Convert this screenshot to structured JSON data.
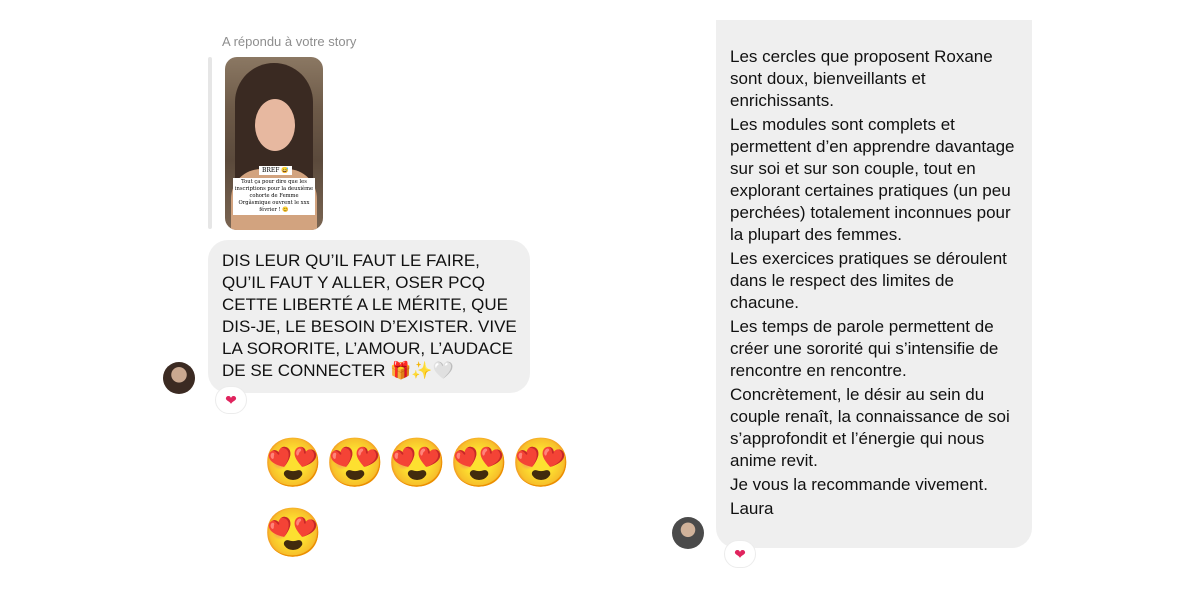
{
  "left_thread": {
    "replied_label": "A répondu à votre story",
    "story_caption_small": "BREF 😅",
    "story_caption": "Tout ça pour dire que les inscriptions pour la deuxième cohorte de Femme Orgãsmique ouvrent le xxx février ! 😊",
    "message_text": "DIS LEUR QU’IL FAUT LE FAIRE,\nQU’IL FAUT Y ALLER, OSER PCQ\nCETTE LIBERTÉ A LE MÉRITE, QUE\nDIS-JE, LE BESOIN D’EXISTER. VIVE\nLA SORORITE, L’AMOUR, L’AUDACE\nDE SE CONNECTER 🎁✨🤍",
    "reaction": "❤",
    "emoji_row_1": [
      "😍",
      "😍",
      "😍",
      "😍",
      "😍"
    ],
    "emoji_row_2": [
      "😍"
    ]
  },
  "right_thread": {
    "paragraphs": [
      "Les cercles que proposent Roxane sont doux, bienveillants et enrichissants.",
      "Les modules sont complets et permettent d’en apprendre davantage sur soi et sur son couple, tout en explorant certaines pratiques (un peu perchées) totalement inconnues pour la plupart des femmes.",
      "Les exercices pratiques se déroulent dans le respect des limites de chacune.",
      "Les temps de parole permettent de créer une sororité qui s’intensifie de rencontre en rencontre.",
      "Concrètement, le désir au sein du couple renaît, la connaissance de soi s’approfondit et l’énergie qui nous anime revit.",
      "Je vous la recommande vivement.",
      "Laura"
    ],
    "reaction": "❤"
  },
  "colors": {
    "bubble": "#efefef",
    "label": "#8e8e8e",
    "heart": "#e0245e"
  }
}
